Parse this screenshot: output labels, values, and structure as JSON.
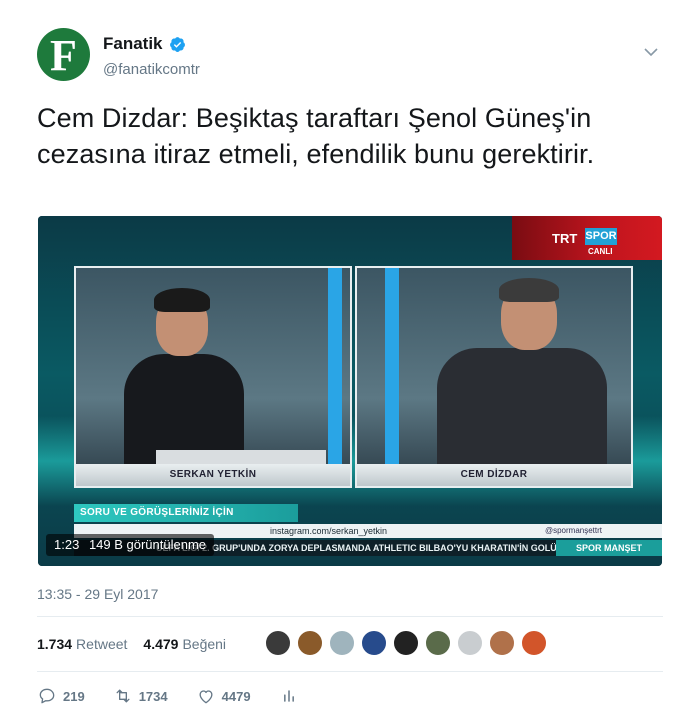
{
  "account": {
    "display_name": "Fanatik",
    "handle": "@fanatikcomtr",
    "avatar_letter": "F",
    "avatar_color": "#1e7a3c",
    "verified": true
  },
  "tweet": {
    "text": "Cem Dizdar: Beşiktaş taraftarı Şenol Güneş'in cezasına itiraz etmeli, efendilik bunu gerektirir.",
    "timestamp": "13:35 - 29 Eyl 2017"
  },
  "media": {
    "channel_trt": "TRT",
    "channel_spor": "SPOR",
    "channel_live": "CANLI",
    "left_name": "SERKAN YETKİN",
    "right_name": "CEM DİZDAR",
    "soru_bar": "SORU VE GÖRÜŞLERİNİZ İÇİN",
    "instagram": "instagram.com/serkan_yetkin",
    "spor_handle": "@spormanşettrt",
    "ticker": "UEFA LİGİ 2. GRUP'UNDA ZORYA DEPLASMANDA ATHLETIC BILBAO'YU KHARATIN'İN GOLÜ",
    "ticker_tag": "SPOR MANŞET",
    "video_time": "1:23",
    "video_views": "149 B görüntülenme"
  },
  "stats": {
    "retweets_count": "1.734",
    "retweets_label": "Retweet",
    "likes_count": "4.479",
    "likes_label": "Beğeni"
  },
  "actions": {
    "reply_count": "219",
    "retweet_count": "1734",
    "like_count": "4479"
  },
  "likers": [
    {
      "color": "#3a3a3a"
    },
    {
      "color": "#8a5a2a"
    },
    {
      "color": "#9fb4bd"
    },
    {
      "color": "#274b8c"
    },
    {
      "color": "#222222"
    },
    {
      "color": "#5a6b4a"
    },
    {
      "color": "#c9cdd0"
    },
    {
      "color": "#b0714a"
    },
    {
      "color": "#d2552a"
    }
  ],
  "colors": {
    "text_primary": "#14171a",
    "text_secondary": "#657786",
    "verified_blue": "#1da1f2"
  }
}
